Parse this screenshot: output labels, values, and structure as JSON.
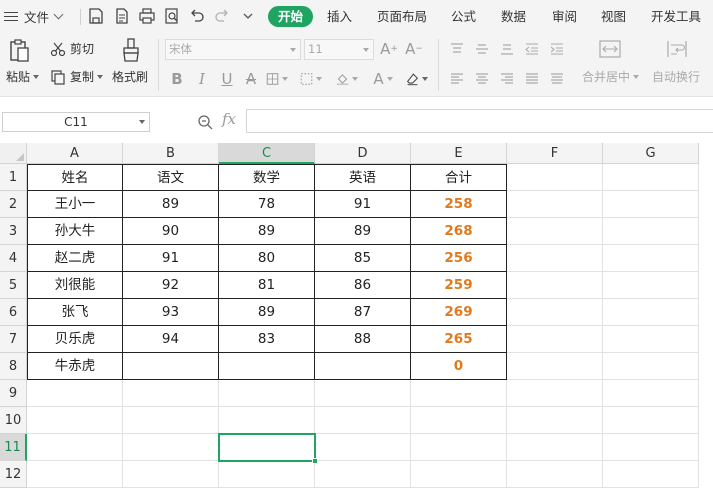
{
  "menu": {
    "file_label": "文件",
    "tabs": [
      "开始",
      "插入",
      "页面布局",
      "公式",
      "数据",
      "审阅",
      "视图",
      "开发工具"
    ],
    "active_tab": "开始",
    "accent_color": "#1fa462"
  },
  "ribbon": {
    "paste_label": "粘贴",
    "cut_label": "剪切",
    "copy_label": "复制",
    "format_painter_label": "格式刷",
    "font_name": "宋体",
    "font_size": "11",
    "merge_label": "合并居中",
    "wrap_label": "自动换行"
  },
  "formula_bar": {
    "name_box": "C11",
    "fx_label": "fx",
    "formula": ""
  },
  "sheet": {
    "columns": [
      "A",
      "B",
      "C",
      "D",
      "E",
      "F",
      "G"
    ],
    "rows": [
      "1",
      "2",
      "3",
      "4",
      "5",
      "6",
      "7",
      "8",
      "9",
      "10",
      "11",
      "12"
    ],
    "selected_column": "C",
    "selected_row": "11",
    "total_color": "#e07a1d",
    "headers": [
      "姓名",
      "语文",
      "数学",
      "英语",
      "合计"
    ],
    "data": [
      [
        "王小一",
        "89",
        "78",
        "91",
        "258"
      ],
      [
        "孙大牛",
        "90",
        "89",
        "89",
        "268"
      ],
      [
        "赵二虎",
        "91",
        "80",
        "85",
        "256"
      ],
      [
        "刘很能",
        "92",
        "81",
        "86",
        "259"
      ],
      [
        "张飞",
        "93",
        "89",
        "87",
        "269"
      ],
      [
        "贝乐虎",
        "94",
        "83",
        "88",
        "265"
      ],
      [
        "牛赤虎",
        "",
        "",
        "",
        "0"
      ]
    ]
  }
}
